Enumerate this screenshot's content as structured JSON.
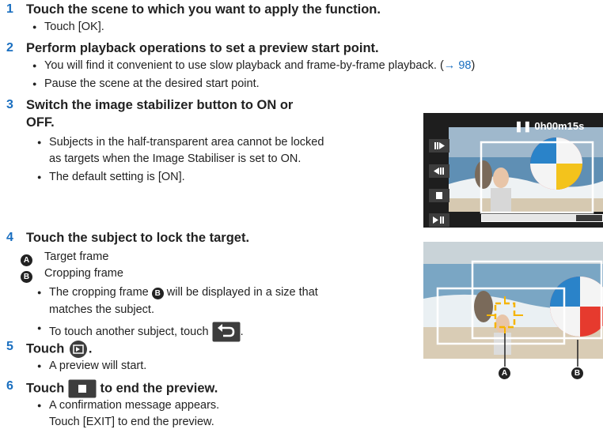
{
  "steps": [
    {
      "num": "1",
      "title": "Touch the scene to which you want to apply the function.",
      "bullets": [
        "Touch [OK]."
      ]
    },
    {
      "num": "2",
      "title": "Perform playback operations to set a preview start point.",
      "bullet1_text": "You will find it convenient to use slow playback and frame-by-frame playback. (",
      "bullet1_link": "→ 98",
      "bullet1_end": ")",
      "bullet2": "Pause the scene at the desired start point."
    },
    {
      "num": "3",
      "title_line1": "Switch the image stabilizer button to ON or",
      "title_line2": "OFF.",
      "bullet1_line1": "Subjects in the half-transparent area cannot be locked",
      "bullet1_line2": "as targets when the Image Stabiliser is set to ON.",
      "bullet2": "The default setting is [ON]."
    },
    {
      "num": "4",
      "title": "Touch the subject to lock the target.",
      "legend": [
        {
          "mark": "A",
          "label": "Target frame"
        },
        {
          "mark": "B",
          "label": "Cropping frame"
        }
      ],
      "bullet1_pre": "The cropping frame",
      "bullet1_mark": "B",
      "bullet1_post": "will be displayed in a size that",
      "bullet1_line2": "matches the subject.",
      "bullet2": "To touch another subject, touch",
      "bullet2_end": "."
    },
    {
      "num": "5",
      "title": "Touch",
      "title_end": ".",
      "bullet": "A preview will start."
    },
    {
      "num": "6",
      "title_pre": "Touch",
      "title_post": "to end the preview.",
      "bullet_line1": "A confirmation message appears.",
      "bullet_line2": "Touch [EXIT] to end the preview."
    }
  ],
  "screen1": {
    "time": "0h00m15s",
    "progress": 0.78,
    "buttons": [
      {
        "icon": "slow-forward-icon"
      },
      {
        "icon": "slow-rewind-icon"
      },
      {
        "icon": "stop-icon"
      },
      {
        "icon": "play-pause-icon"
      }
    ]
  },
  "screen2": {
    "marker_a": "A",
    "marker_b": "B"
  },
  "colors": {
    "step_number": "#1a6fc0",
    "link": "#1a6fc0",
    "target_frame": "#f5b400"
  }
}
